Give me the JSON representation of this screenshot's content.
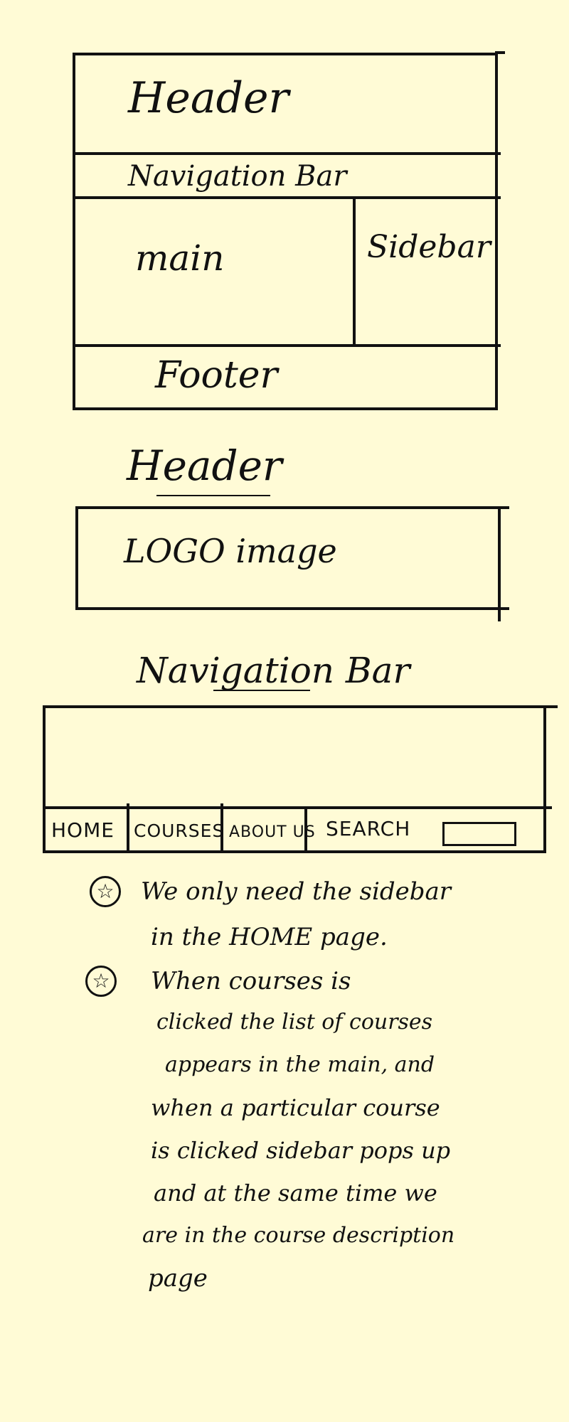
{
  "layout_sketch": {
    "header_label": "Header",
    "nav_label": "Navigation Bar",
    "main_label": "main",
    "sidebar_label": "Sidebar",
    "footer_label": "Footer"
  },
  "header_section": {
    "title": "Header",
    "logo_label": "LOGO image"
  },
  "nav_section": {
    "title": "Navigation Bar",
    "items": [
      "HOME",
      "COURSES",
      "ABOUT US",
      "SEARCH"
    ]
  },
  "notes": {
    "bullet_icon": "star-in-circle",
    "note1_lines": [
      "We only need the sidebar",
      "in the HOME page."
    ],
    "note2_lines": [
      "When courses is",
      "clicked the list of courses",
      "appears in the main, and",
      "when a particular course",
      "is clicked sidebar pops up",
      "and at the same time we",
      "are in the course description",
      "page"
    ]
  }
}
